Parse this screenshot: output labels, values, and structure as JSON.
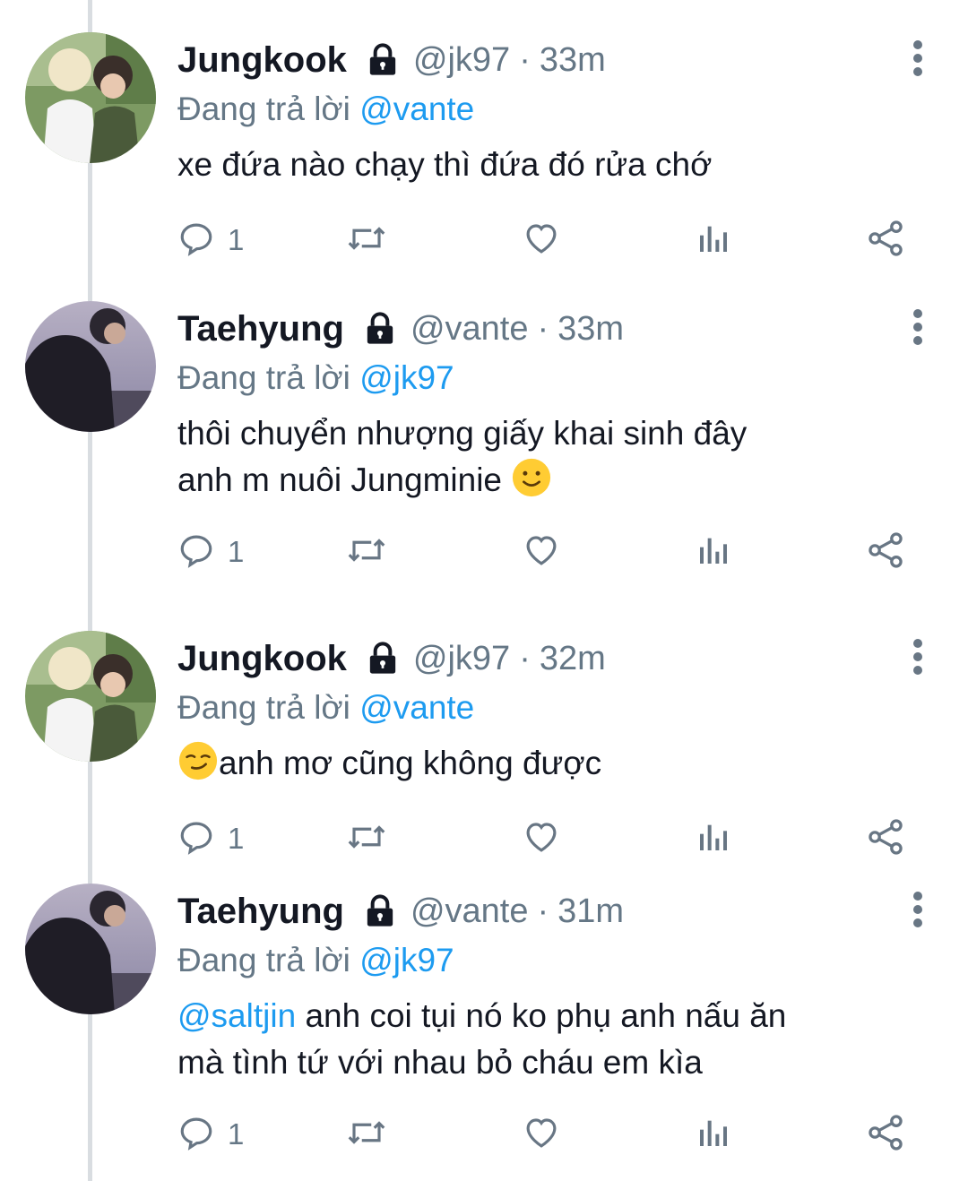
{
  "tweets": [
    {
      "name": "Jungkook",
      "handle": "@jk97",
      "separator": "·",
      "time": "33m",
      "replying_prefix": "Đang trả lời",
      "replying_to": "@vante",
      "text_parts": [
        "xe đứa nào chạy thì đứa đó rửa chớ"
      ],
      "reply_count": "1"
    },
    {
      "name": "Taehyung",
      "handle": "@vante",
      "separator": "·",
      "time": "33m",
      "replying_prefix": "Đang trả lời",
      "replying_to": "@jk97",
      "text_parts": [
        "thôi chuyển nhượng giấy khai sinh đây",
        "anh m nuôi Jungminie"
      ],
      "emoji": "slightly-smiling-face",
      "reply_count": "1"
    },
    {
      "name": "Jungkook",
      "handle": "@jk97",
      "separator": "·",
      "time": "32m",
      "replying_prefix": "Đang trả lời",
      "replying_to": "@vante",
      "text_parts": [
        "anh mơ cũng không được"
      ],
      "emoji": "smirking-face",
      "reply_count": "1"
    },
    {
      "name": "Taehyung",
      "handle": "@vante",
      "separator": "·",
      "time": "31m",
      "replying_prefix": "Đang trả lời",
      "replying_to": "@jk97",
      "text_mention": "@saltjin",
      "text_parts": [
        "anh coi tụi nó ko phụ anh nấu ăn",
        "mà tình tứ với nhau bỏ cháu em kìa"
      ],
      "reply_count": "1"
    }
  ],
  "colors": {
    "link": "#1d9bf0",
    "secondary": "#657786",
    "text": "#141823",
    "thread_line": "#d9dde1"
  },
  "icons": [
    "lock-icon",
    "more-vertical-icon",
    "reply-icon",
    "retweet-icon",
    "like-icon",
    "stats-icon",
    "share-icon"
  ]
}
